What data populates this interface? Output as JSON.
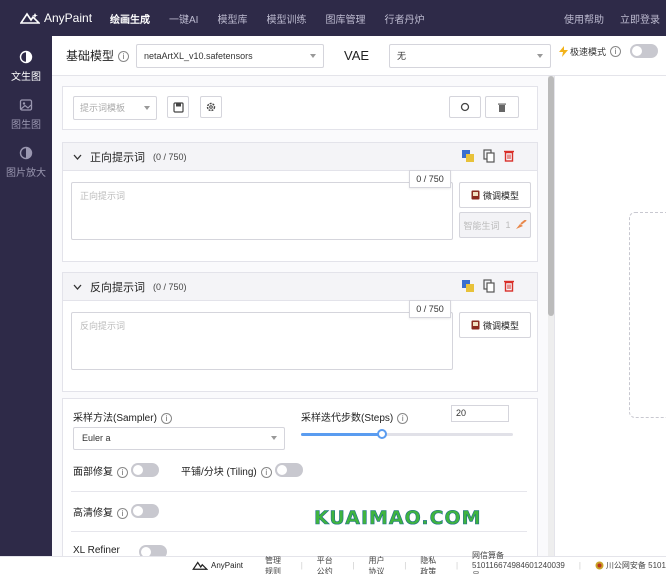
{
  "brand": {
    "name": "AnyPaint"
  },
  "nav": {
    "items": [
      {
        "label": "绘画生成",
        "active": true
      },
      {
        "label": "一键AI",
        "active": false
      },
      {
        "label": "模型库",
        "active": false
      },
      {
        "label": "模型训练",
        "active": false
      },
      {
        "label": "图库管理",
        "active": false
      },
      {
        "label": "行者丹炉",
        "active": false
      }
    ],
    "help": "使用帮助",
    "login": "立即登录"
  },
  "sidebar": {
    "items": [
      {
        "label": "文生图",
        "active": true
      },
      {
        "label": "图生图",
        "active": false
      },
      {
        "label": "图片放大",
        "active": false
      }
    ]
  },
  "model_row": {
    "base_model_label": "基础模型",
    "base_model_value": "netaArtXL_v10.safetensors",
    "vae_label": "VAE",
    "vae_value": "无",
    "fast_mode_label": "极速模式"
  },
  "toolbar": {
    "template_placeholder": "提示词模板"
  },
  "positive": {
    "title": "正向提示词",
    "count": "(0 / 750)",
    "counter": "0 / 750",
    "placeholder": "正向提示词",
    "finetune_label": "微调模型",
    "smart_label": "智能生词",
    "smart_badge": "1"
  },
  "negative": {
    "title": "反向提示词",
    "count": "(0 / 750)",
    "counter": "0 / 750",
    "placeholder": "反向提示词",
    "finetune_label": "微调模型"
  },
  "params": {
    "sampler_label": "采样方法(Sampler)",
    "sampler_value": "Euler a",
    "steps_label": "采样迭代步数(Steps)",
    "steps_value": "20",
    "steps_fraction": 0.38,
    "face_restore_label": "面部修复",
    "tiling_label": "平铺/分块 (Tiling)",
    "hires_label": "高清修复",
    "refiner_label": "XL Refiner"
  },
  "watermark": {
    "text": "KUAIMAO.COM"
  },
  "footer": {
    "brand": "AnyPaint",
    "links": [
      "管理规则",
      "平台公约",
      "用户协议",
      "隐私政策"
    ],
    "icp": "网信算备 510116674984601240039号",
    "police": "川公网安备 5101"
  },
  "colors": {
    "nav_bg": "#2e2a48",
    "accent": "#5a9cf0",
    "danger": "#d9302a"
  }
}
